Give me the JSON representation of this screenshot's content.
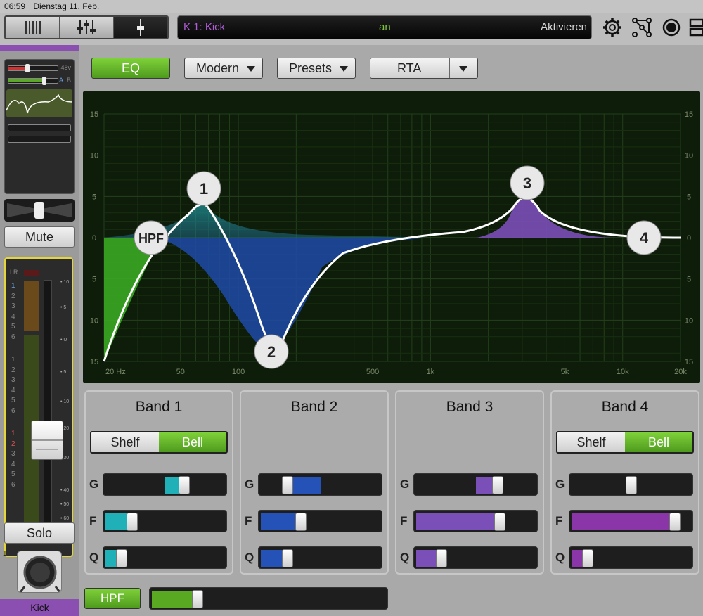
{
  "status": {
    "time": "06:59",
    "date": "Dienstag 11. Feb."
  },
  "channel": {
    "name": "K 1: Kick",
    "state": "an",
    "action": "Aktivieren"
  },
  "strip": {
    "phantom_label": "48v",
    "ab_a": "A",
    "ab_b": "B",
    "mute": "Mute",
    "solo": "Solo",
    "channel_number": "1",
    "channel_name": "Kick",
    "meter_lr": "LR",
    "meter_left_labels": [
      "1",
      "2",
      "3",
      "4",
      "5",
      "6",
      "1",
      "2",
      "3",
      "4",
      "5",
      "6",
      "1",
      "2",
      "3",
      "4",
      "5",
      "6"
    ],
    "fader_scale": [
      "10",
      "5",
      "U",
      "5",
      "10",
      "20",
      "30",
      "40",
      "50",
      "60",
      "∞"
    ]
  },
  "eq": {
    "toggle_label": "EQ",
    "mode": "Modern",
    "presets": "Presets",
    "rta": "RTA"
  },
  "graph": {
    "y_ticks": [
      "15",
      "10",
      "5",
      "0",
      "5",
      "10",
      "15"
    ],
    "x_ticks": [
      "20 Hz",
      "50",
      "100",
      "500",
      "1k",
      "5k",
      "10k",
      "20k"
    ],
    "nodes": {
      "hpf": "HPF",
      "b1": "1",
      "b2": "2",
      "b3": "3",
      "b4": "4"
    }
  },
  "bands": [
    {
      "title": "Band 1",
      "shelf": "Shelf",
      "bell": "Bell",
      "g": 0.68,
      "f": 0.2,
      "q": 0.1,
      "color": "#20b0b8"
    },
    {
      "title": "Band 2",
      "g": 0.2,
      "f": 0.32,
      "q": 0.2,
      "color": "#2452b6"
    },
    {
      "title": "Band 3",
      "g": 0.7,
      "f": 0.72,
      "q": 0.19,
      "color": "#7b4fb8"
    },
    {
      "title": "Band 4",
      "shelf": "Shelf",
      "bell": "Bell",
      "g": 0.5,
      "f": 0.9,
      "q": 0.1,
      "color": "#8a35a8"
    }
  ],
  "param_labels": {
    "g": "G",
    "f": "F",
    "q": "Q"
  },
  "hpf": {
    "label": "HPF",
    "value": 0.18
  },
  "colors": {
    "green": "#5aa922",
    "purple": "#8a4fb0",
    "yellow": "#e3d53b"
  }
}
